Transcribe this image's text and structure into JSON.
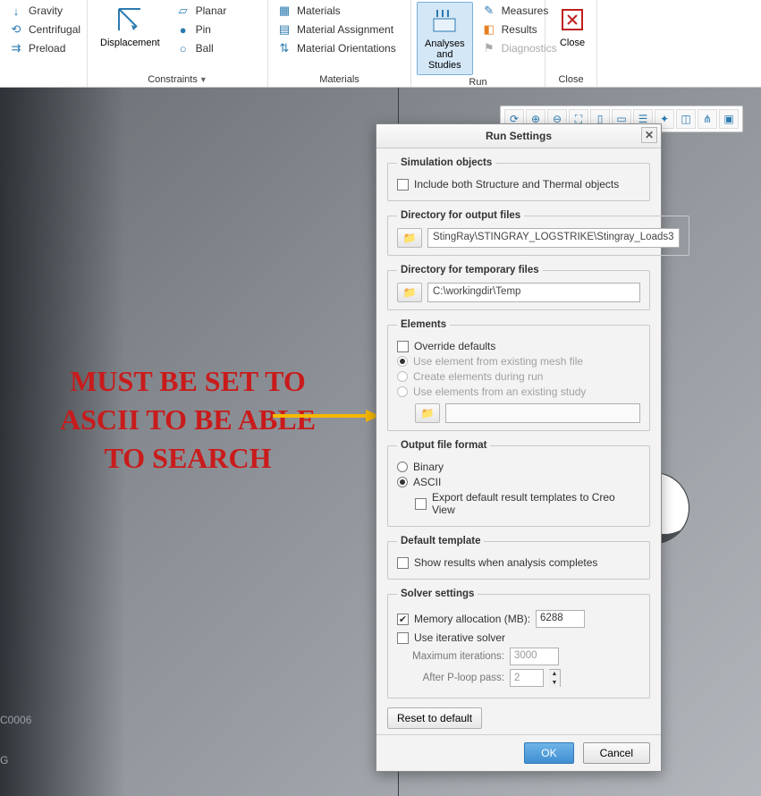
{
  "ribbon": {
    "group0": {
      "items": [
        "Gravity",
        "Centrifugal",
        "Preload"
      ]
    },
    "group1": {
      "big": "Displacement",
      "colA": [
        "Planar",
        "Pin",
        "Ball"
      ],
      "label": "Constraints"
    },
    "group2": {
      "items": [
        "Materials",
        "Material Assignment",
        "Material Orientations"
      ],
      "label": "Materials"
    },
    "group3": {
      "big": "Analyses\nand Studies",
      "items": [
        "Measures",
        "Results",
        "Diagnostics"
      ],
      "label": "Run"
    },
    "group4": {
      "big": "Close",
      "label": "Close"
    }
  },
  "annotation": "MUST BE SET TO ASCII TO BE ABLE TO SEARCH",
  "canvas_text1": "C0006",
  "canvas_text2": "G",
  "dialog": {
    "title": "Run Settings",
    "section1": {
      "legend": "Simulation objects",
      "chk1": "Include both Structure and Thermal objects"
    },
    "section2": {
      "legend": "Directory for output files",
      "path": "StingRay\\STINGRAY_LOGSTRIKE\\Stingray_Loads3"
    },
    "section3": {
      "legend": "Directory for temporary files",
      "path": "C:\\workingdir\\Temp"
    },
    "section4": {
      "legend": "Elements",
      "chk1": "Override defaults",
      "r1": "Use element from existing mesh file",
      "r2": "Create elements during run",
      "r3": "Use elements from an existing study"
    },
    "section5": {
      "legend": "Output file format",
      "r1": "Binary",
      "r2": "ASCII",
      "chk1": "Export default result templates to Creo View"
    },
    "section6": {
      "legend": "Default template",
      "chk1": "Show results when analysis completes"
    },
    "section7": {
      "legend": "Solver settings",
      "chk1": "Memory allocation (MB):",
      "mem_val": "6288",
      "chk2": "Use iterative solver",
      "lbl_iter": "Maximum iterations:",
      "iter_val": "3000",
      "lbl_ploop": "After P-loop pass:",
      "ploop_val": "2"
    },
    "reset": "Reset to default",
    "ok": "OK",
    "cancel": "Cancel"
  }
}
